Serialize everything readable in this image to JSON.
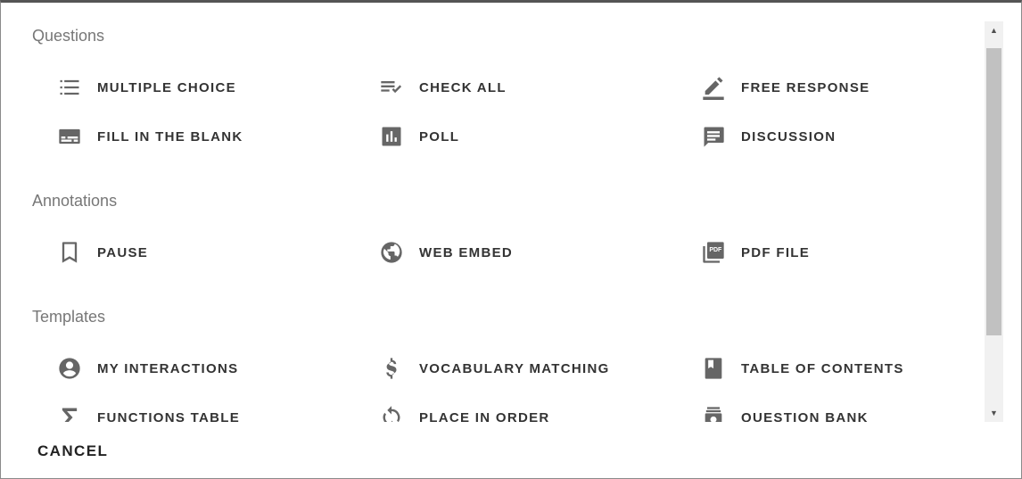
{
  "sections": {
    "questions": {
      "title": "Questions",
      "items": [
        {
          "label": "MULTIPLE CHOICE",
          "icon": "list-icon"
        },
        {
          "label": "CHECK ALL",
          "icon": "playlist-check-icon"
        },
        {
          "label": "FREE RESPONSE",
          "icon": "pencil-icon"
        },
        {
          "label": "FILL IN THE BLANK",
          "icon": "subtitles-icon"
        },
        {
          "label": "POLL",
          "icon": "bar-chart-icon"
        },
        {
          "label": "DISCUSSION",
          "icon": "chat-icon"
        }
      ]
    },
    "annotations": {
      "title": "Annotations",
      "items": [
        {
          "label": "PAUSE",
          "icon": "bookmark-icon"
        },
        {
          "label": "WEB EMBED",
          "icon": "globe-icon"
        },
        {
          "label": "PDF FILE",
          "icon": "pdf-icon"
        }
      ]
    },
    "templates": {
      "title": "Templates",
      "items": [
        {
          "label": "MY INTERACTIONS",
          "icon": "account-circle-icon"
        },
        {
          "label": "VOCABULARY MATCHING",
          "icon": "dollar-icon"
        },
        {
          "label": "TABLE OF CONTENTS",
          "icon": "book-icon"
        },
        {
          "label": "FUNCTIONS TABLE",
          "icon": "sigma-icon"
        },
        {
          "label": "PLACE IN ORDER",
          "icon": "sync-icon"
        },
        {
          "label": "QUESTION BANK",
          "icon": "bank-icon"
        }
      ]
    }
  },
  "footer": {
    "cancel_label": "CANCEL"
  },
  "colors": {
    "icon": "#666666",
    "label": "#333333",
    "section_title": "#777777",
    "scroll_thumb": "#c1c1c1"
  }
}
